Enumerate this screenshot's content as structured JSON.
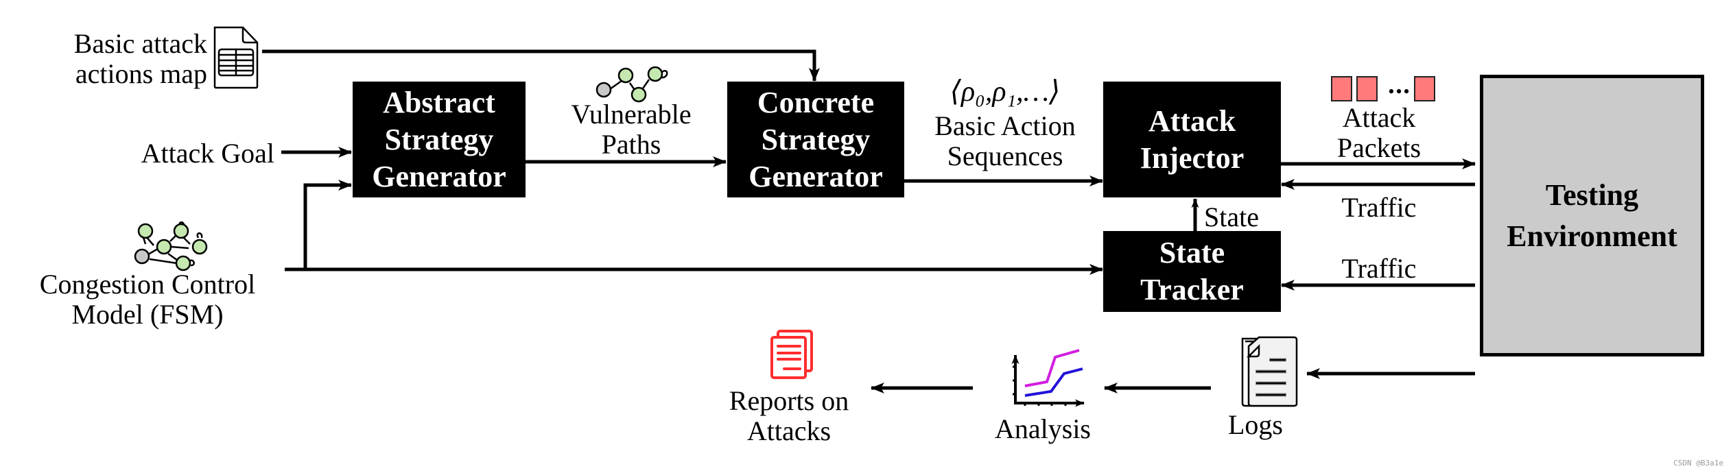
{
  "inputs": {
    "basic_attack_actions_map": "Basic attack\nactions map",
    "attack_goal": "Attack Goal",
    "congestion_control_model": "Congestion Control\nModel (FSM)"
  },
  "blocks": {
    "abstract_strategy_generator": "Abstract\nStrategy\nGenerator",
    "concrete_strategy_generator": "Concrete\nStrategy\nGenerator",
    "attack_injector": "Attack\nInjector",
    "state_tracker": "State\nTracker",
    "testing_environment": "Testing\nEnvironment"
  },
  "edge_labels": {
    "vulnerable_paths": "Vulnerable\nPaths",
    "action_sequence_formula": "⟨ρ₀,ρ₁,…⟩",
    "basic_action_sequences": "Basic Action\nSequences",
    "attack_packets": "Attack\nPackets",
    "traffic_to_injector": "Traffic",
    "traffic_to_tracker": "Traffic",
    "state": "State",
    "packet_ellipsis": "•••"
  },
  "outputs": {
    "logs": "Logs",
    "analysis": "Analysis",
    "reports_on_attacks": "Reports on\nAttacks"
  },
  "colors": {
    "block_fill": "#000000",
    "environment_fill": "#cbcbcb",
    "fsm_node_green": "#c5e8b0",
    "fsm_node_gray": "#c8c8c8",
    "packet_fill": "#ff7b7b",
    "report_icon": "#ff2d2d",
    "chart_line_magenta": "#d21ee0",
    "chart_line_blue": "#2312d8"
  },
  "watermark": "CSDN @B3a1e"
}
